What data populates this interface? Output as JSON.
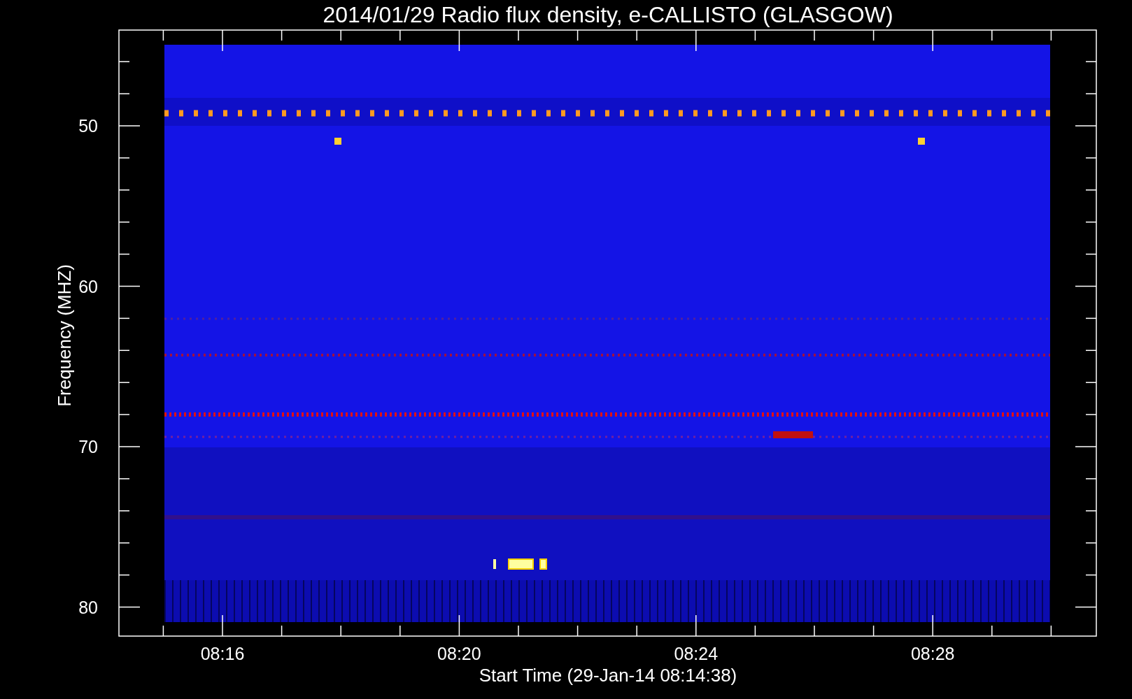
{
  "title": "2014/01/29  Radio flux density, e-CALLISTO (GLASGOW)",
  "y_axis": {
    "label": "Frequency (MHZ)",
    "tick_labels": [
      "50",
      "60",
      "70",
      "80"
    ]
  },
  "x_axis": {
    "label": "Start Time (29-Jan-14 08:14:38)",
    "tick_labels": [
      "08:16",
      "08:20",
      "08:24",
      "08:28"
    ]
  }
}
